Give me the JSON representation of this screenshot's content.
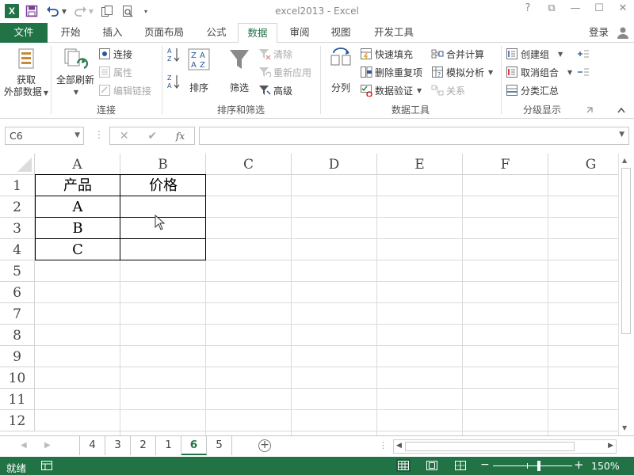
{
  "window": {
    "title": "excel2013 - Excel",
    "help": "?",
    "restore": "⧉",
    "minimize": "—",
    "maximize": "☐",
    "close": "✕"
  },
  "qat": {
    "logo": "X"
  },
  "tabs": {
    "file": "文件",
    "items": [
      "开始",
      "插入",
      "页面布局",
      "公式",
      "数据",
      "审阅",
      "视图",
      "开发工具"
    ],
    "active": "数据",
    "login": "登录"
  },
  "ribbon": {
    "get_external": {
      "line1": "获取",
      "line2": "外部数据"
    },
    "refresh_all": "全部刷新",
    "connections": "连接",
    "properties": "属性",
    "edit_links": "编辑链接",
    "group_connections": "连接",
    "sort_az": "A→Z",
    "sort": "排序",
    "filter": "筛选",
    "clear": "清除",
    "reapply": "重新应用",
    "advanced": "高级",
    "group_sort_filter": "排序和筛选",
    "text_to_columns": "分列",
    "flash_fill": "快速填充",
    "remove_duplicates": "删除重复项",
    "data_validation": "数据验证",
    "consolidate": "合并计算",
    "what_if": "模拟分析",
    "relationships": "关系",
    "group_data_tools": "数据工具",
    "group": "创建组",
    "ungroup": "取消组合",
    "subtotal": "分类汇总",
    "group_outline": "分级显示"
  },
  "formula_bar": {
    "name_box": "C6",
    "cancel": "✕",
    "enter": "✔",
    "fx": "fx",
    "value": ""
  },
  "grid": {
    "columns": [
      "A",
      "B",
      "C",
      "D",
      "E",
      "F",
      "G"
    ],
    "rows": [
      "1",
      "2",
      "3",
      "4",
      "5",
      "6",
      "7",
      "8",
      "9",
      "10",
      "11",
      "12"
    ],
    "cells": {
      "A1": "产品",
      "B1": "价格",
      "A2": "A",
      "A3": "B",
      "A4": "C"
    }
  },
  "sheets": {
    "tabs": [
      "4",
      "3",
      "2",
      "1",
      "6",
      "5"
    ],
    "active": "6",
    "add": "+"
  },
  "status": {
    "ready": "就绪",
    "zoom_minus": "−",
    "zoom_plus": "+",
    "zoom_level": "150%",
    "zoom_percent": 150
  },
  "colors": {
    "accent": "#217346",
    "grid_line": "#dadada",
    "text": "#444444"
  }
}
